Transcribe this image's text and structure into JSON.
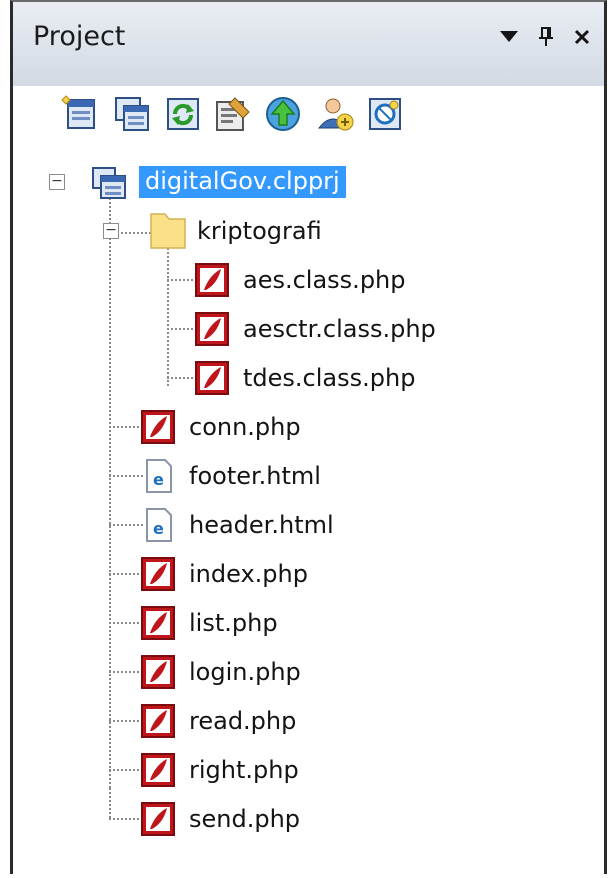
{
  "panel": {
    "title": "Project",
    "controls": {
      "dropdown_icon": "triangle-down-icon",
      "pin_icon": "pin-icon",
      "close_icon": "close-icon"
    }
  },
  "toolbar": {
    "buttons": [
      {
        "icon": "new-file-icon"
      },
      {
        "icon": "new-project-icon"
      },
      {
        "icon": "refresh-icon"
      },
      {
        "icon": "properties-icon"
      },
      {
        "icon": "upload-icon"
      },
      {
        "icon": "add-user-icon"
      },
      {
        "icon": "browse-icon"
      }
    ]
  },
  "tree": {
    "root": {
      "label": "digitalGov.clpprj",
      "selected": true,
      "icon": "project-icon"
    },
    "folder": {
      "label": "kriptografi",
      "icon": "folder-icon"
    },
    "folder_children": [
      {
        "label": "aes.class.php",
        "icon": "php-file-icon"
      },
      {
        "label": "aesctr.class.php",
        "icon": "php-file-icon"
      },
      {
        "label": "tdes.class.php",
        "icon": "php-file-icon"
      }
    ],
    "root_children": [
      {
        "label": "conn.php",
        "icon": "php-file-icon"
      },
      {
        "label": "footer.html",
        "icon": "html-file-icon"
      },
      {
        "label": "header.html",
        "icon": "html-file-icon"
      },
      {
        "label": "index.php",
        "icon": "php-file-icon"
      },
      {
        "label": "list.php",
        "icon": "php-file-icon"
      },
      {
        "label": "login.php",
        "icon": "php-file-icon"
      },
      {
        "label": "read.php",
        "icon": "php-file-icon"
      },
      {
        "label": "right.php",
        "icon": "php-file-icon"
      },
      {
        "label": "send.php",
        "icon": "php-file-icon"
      }
    ]
  },
  "colors": {
    "selection": "#3399ff",
    "php_icon": "#c0161b",
    "html_icon": "#1f6fc0",
    "folder": "#fbe08a"
  }
}
